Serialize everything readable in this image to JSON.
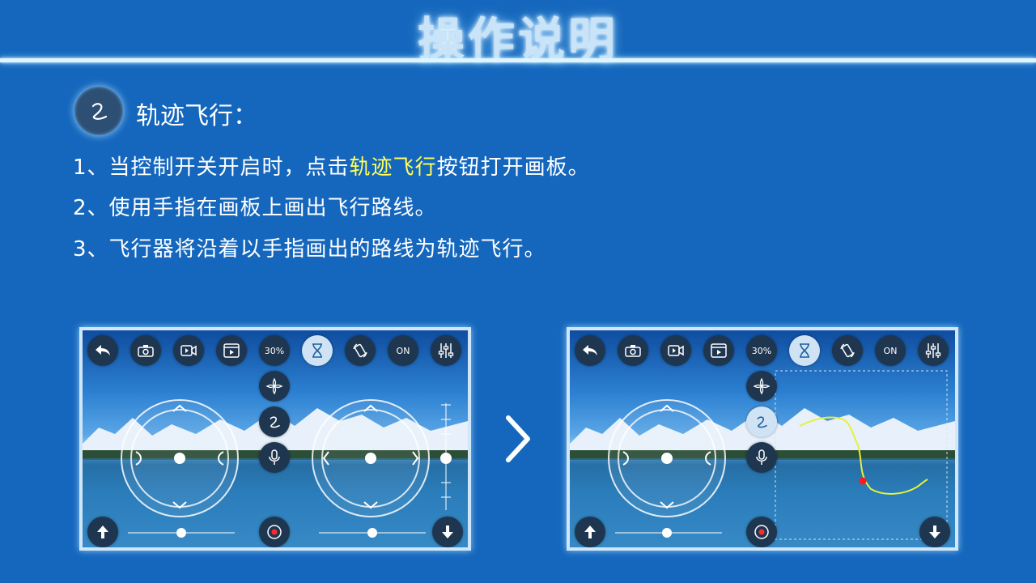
{
  "page": {
    "title": "操作说明",
    "feature_title": "轨迹飞行：",
    "steps": [
      {
        "prefix": "1、当控制开关开启时，点击",
        "highlight": "轨迹飞行",
        "suffix": "按钮打开画板。"
      },
      {
        "text": "2、使用手指在画板上画出飞行路线。"
      },
      {
        "text": "3、飞行器将沿着以手指画出的路线为轨迹飞行。"
      }
    ]
  },
  "toolbar": {
    "speed_label": "30%",
    "switch_label": "ON"
  },
  "icons": [
    "back-icon",
    "camera-icon",
    "video-icon",
    "gallery-icon",
    "hourglass-icon",
    "rotate-icon",
    "settings-sliders-icon",
    "drone-icon",
    "trajectory-icon",
    "microphone-icon",
    "up-arrow-icon",
    "down-arrow-icon",
    "record-icon",
    "next-chevron-icon"
  ],
  "colors": {
    "background": "#1567bd",
    "highlight": "#ffff5a",
    "trajectory_line": "#e6f03a",
    "drone_marker": "#ff1a1a"
  }
}
